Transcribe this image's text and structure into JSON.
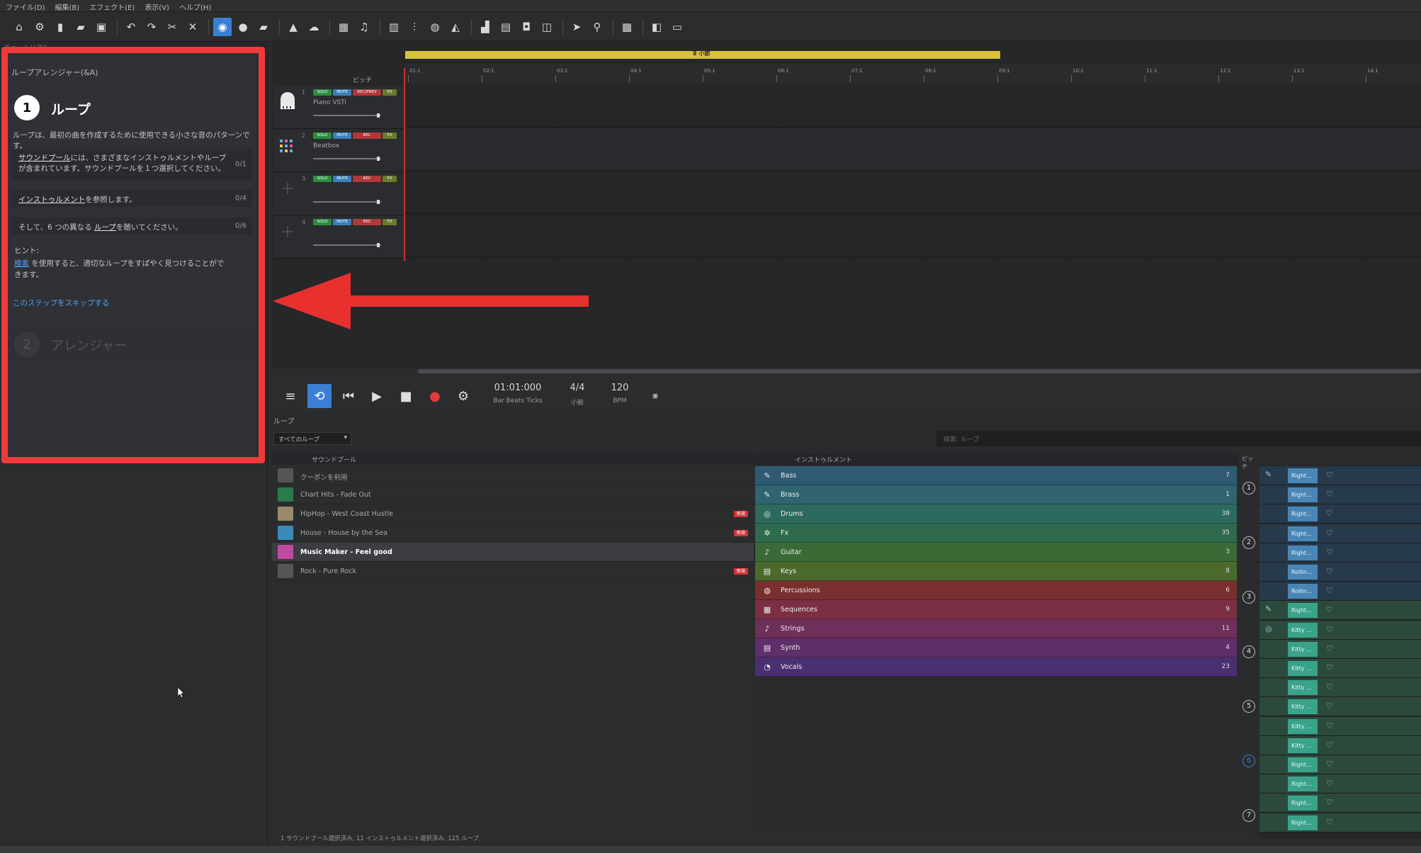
{
  "menu": [
    "ファイル(D)",
    "編集(B)",
    "エフェクト(E)",
    "表示(V)",
    "ヘルプ(H)"
  ],
  "toolbar_icons": [
    "home-icon",
    "gear-icon",
    "new-file-icon",
    "open-folder-icon",
    "save-icon",
    "undo-icon",
    "redo-icon",
    "cut-icon",
    "delete-icon",
    "loop-mode-icon",
    "record-icon",
    "folder-icon",
    "bag-icon",
    "upload-icon",
    "grid-icon",
    "note-icon",
    "piano-icon",
    "mixer-icon",
    "tempo-icon",
    "volume-icon",
    "bars-icon",
    "screen-icon",
    "video-icon",
    "split-icon",
    "pointer-icon",
    "tool-icon",
    "snap-icon",
    "export-icon",
    "monitor-icon"
  ],
  "tutorial": {
    "header": "チュートリアル",
    "subtitle": "ループアレンジャー(&A)",
    "step1": {
      "number": "1",
      "title": "ループ"
    },
    "description": "ループは、最初の曲を作成するために使用できる小さな音のパターンです。",
    "tasks": [
      {
        "link": "サウンドプール",
        "text": "には、さまざまなインストゥルメントやループが含まれています。サウンドプールを１つ選択してください。",
        "count": "0/1"
      },
      {
        "link": "インストゥルメント",
        "text": "を参照します。",
        "count": "0/4"
      },
      {
        "prefix": "そして、6 つの異なる ",
        "link": "ループ",
        "text": "を聴いてください。",
        "count": "0/6"
      }
    ],
    "hint_label": "ヒント:",
    "hint_link": "検索",
    "hint_text": "を使用すると、適切なループをすばやく見つけることができます。",
    "skip": "このステップをスキップする",
    "step2": {
      "number": "2",
      "title": "アレンジャー"
    }
  },
  "arranger": {
    "pitch_label": "ピッチ",
    "loop_marker": "8 小節",
    "ruler": [
      "01:1",
      "02:1",
      "03:1",
      "04:1",
      "05:1",
      "06:1",
      "07:1",
      "08:1",
      "09:1",
      "10:1",
      "11:1",
      "12:1",
      "13:1",
      "14:1"
    ],
    "tracks": [
      {
        "num": "1",
        "name": "Piano VSTi",
        "solo": "SOLO",
        "mute": "MUTE",
        "rec": "REC/PREV",
        "fx": "FX"
      },
      {
        "num": "2",
        "name": "Beatbox",
        "solo": "SOLO",
        "mute": "MUTE",
        "rec": "REC",
        "fx": "FX"
      },
      {
        "num": "3",
        "name": "",
        "solo": "SOLO",
        "mute": "MUTE",
        "rec": "REC",
        "fx": "FX"
      },
      {
        "num": "4",
        "name": "",
        "solo": "SOLO",
        "mute": "MUTE",
        "rec": "REC",
        "fx": "FX"
      }
    ]
  },
  "transport": {
    "position": "01:01:000",
    "position_sub": "Bar Beats Ticks",
    "signature": "4/4",
    "signature_sub": "小節",
    "tempo": "120",
    "tempo_sub": "BPM"
  },
  "loops": {
    "label": "ループ",
    "filter": "すべてのループ",
    "search_placeholder": "検索: ループ",
    "soundpool_header": "サウンドプール",
    "instrument_header": "インストゥルメント",
    "pitch_header": "ピッチ",
    "soundpools": [
      {
        "name": "クーポンを利用",
        "badge": "",
        "thumb": "#555"
      },
      {
        "name": "Chart Hits - Fade Out",
        "badge": "",
        "thumb": "#2a7a4a"
      },
      {
        "name": "HipHop - West Coast Hustle",
        "badge": "新規",
        "thumb": "#9a8a6a"
      },
      {
        "name": "House - House by the Sea",
        "badge": "新規",
        "thumb": "#3a8ab8"
      },
      {
        "name": "Music Maker - Feel good",
        "badge": "",
        "thumb": "#c04aa0",
        "selected": true
      },
      {
        "name": "Rock - Pure Rock",
        "badge": "新規",
        "thumb": "#555"
      }
    ],
    "instruments": [
      {
        "name": "Bass",
        "count": "7",
        "color": "#2f5a72",
        "icon": "bass-icon"
      },
      {
        "name": "Brass",
        "count": "1",
        "color": "#2f6470",
        "icon": "brass-icon"
      },
      {
        "name": "Drums",
        "count": "38",
        "color": "#2d6a5e",
        "icon": "drums-icon"
      },
      {
        "name": "Fx",
        "count": "35",
        "color": "#2f6a4e",
        "icon": "fx-icon"
      },
      {
        "name": "Guitar",
        "count": "3",
        "color": "#3a6a36",
        "icon": "guitar-icon"
      },
      {
        "name": "Keys",
        "count": "8",
        "color": "#4a6a2c",
        "icon": "keys-icon"
      },
      {
        "name": "Percussions",
        "count": "6",
        "color": "#7a2f2f",
        "icon": "percussion-icon"
      },
      {
        "name": "Sequences",
        "count": "9",
        "color": "#7a2f42",
        "icon": "sequence-icon"
      },
      {
        "name": "Strings",
        "count": "11",
        "color": "#6e2f5a",
        "icon": "strings-icon"
      },
      {
        "name": "Synth",
        "count": "4",
        "color": "#5e2f6a",
        "icon": "synth-icon"
      },
      {
        "name": "Vocals",
        "count": "23",
        "color": "#4a2f72",
        "icon": "vocals-icon"
      }
    ],
    "pitches": [
      {
        "num": "1",
        "active": false
      },
      {
        "num": "2",
        "active": false
      },
      {
        "num": "3",
        "active": false
      },
      {
        "num": "4",
        "active": false
      },
      {
        "num": "5",
        "active": false
      },
      {
        "num": "6",
        "active": true
      },
      {
        "num": "7",
        "active": false
      }
    ],
    "loop_items": [
      "Right...",
      "Right...",
      "Right...",
      "Right...",
      "Right...",
      "Rollin...",
      "Rollin...",
      "Right...",
      "Kitty ...",
      "Kitty ...",
      "Kitty ...",
      "Kitty ...",
      "Kitty ...",
      "Kitty ...",
      "Kitty ...",
      "Right...",
      "Right...",
      "Right...",
      "Right..."
    ],
    "status": "1 サウンドプール選択済み, 11 インストゥルメント選択済み, 125 ループ."
  }
}
